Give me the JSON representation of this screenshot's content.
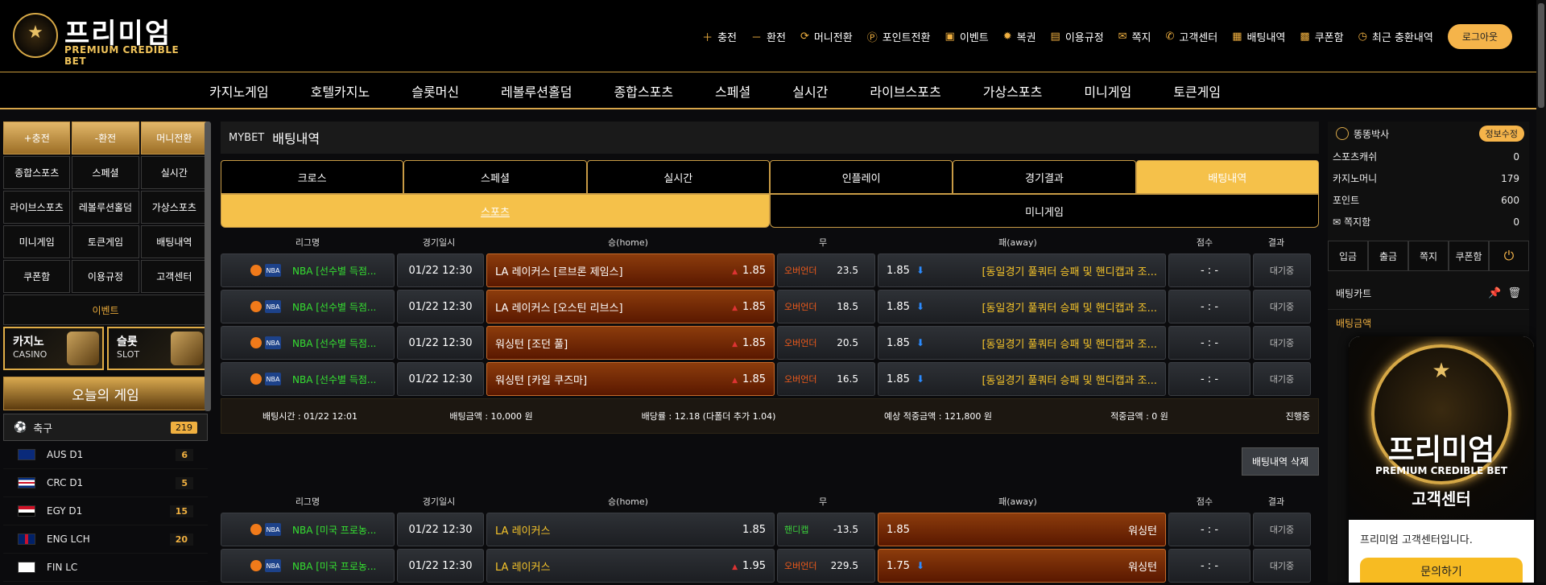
{
  "brand": {
    "name_kr": "프리미엄",
    "name_en": "PREMIUM CREDIBLE BET"
  },
  "top_menu": [
    {
      "icon": "plus-icon",
      "label": "충전"
    },
    {
      "icon": "minus-icon",
      "label": "환전"
    },
    {
      "icon": "exchange-icon",
      "label": "머니전환"
    },
    {
      "icon": "point-icon",
      "label": "포인트전환"
    },
    {
      "icon": "gift-icon",
      "label": "이벤트"
    },
    {
      "icon": "gear-icon",
      "label": "복권"
    },
    {
      "icon": "document-icon",
      "label": "이용규정"
    },
    {
      "icon": "mail-icon",
      "label": "쪽지"
    },
    {
      "icon": "phone-icon",
      "label": "고객센터"
    },
    {
      "icon": "list-icon",
      "label": "배팅내역"
    },
    {
      "icon": "grid-icon",
      "label": "쿠폰함"
    },
    {
      "icon": "clock-icon",
      "label": "최근 충환내역"
    }
  ],
  "logout": "로그아웃",
  "nav": [
    "카지노게임",
    "호텔카지노",
    "슬롯머신",
    "레볼루션홀덤",
    "종합스포츠",
    "스페셜",
    "실시간",
    "라이브스포츠",
    "가상스포츠",
    "미니게임",
    "토큰게임"
  ],
  "left_buttons": [
    "+충전",
    "-환전",
    "머니전환",
    "종합스포츠",
    "스페셜",
    "실시간",
    "라이브스포츠",
    "레볼루션홀덤",
    "가상스포츠",
    "미니게임",
    "토큰게임",
    "배팅내역",
    "쿠폰함",
    "이용규정",
    "고객센터"
  ],
  "left_event": "이벤트",
  "banners": [
    {
      "title": "카지노",
      "sub": "CASINO"
    },
    {
      "title": "슬롯",
      "sub": "SLOT"
    }
  ],
  "today": "오늘의 게임",
  "soccer": {
    "label": "축구",
    "count": "219"
  },
  "leagues": [
    {
      "name": "AUS D1",
      "count": "6"
    },
    {
      "name": "CRC D1",
      "count": "5"
    },
    {
      "name": "EGY D1",
      "count": "15"
    },
    {
      "name": "ENG LCH",
      "count": "20"
    },
    {
      "name": "FIN LC",
      "count": ""
    }
  ],
  "main": {
    "crumb": "MYBET",
    "title": "배팅내역",
    "tabs": [
      "크로스",
      "스페셜",
      "실시간",
      "인플레이",
      "경기결과",
      "배팅내역"
    ],
    "subtabs": [
      "스포츠",
      "미니게임"
    ],
    "headers": [
      "리그명",
      "경기일시",
      "승(home)",
      "무",
      "패(away)",
      "점수",
      "결과"
    ],
    "bet1": [
      {
        "league": "NBA [선수별 득점...",
        "date": "01/22 12:30",
        "home": "LA 레이커스 [르브론 제임스]",
        "home_odds": "1.85",
        "draw_type": "오버언더",
        "draw_val": "23.5",
        "away_odds": "1.85",
        "away": "[동일경기 풀쿼터 승패 및 핸디캡과 조...",
        "score": "- : -",
        "result": "대기중"
      },
      {
        "league": "NBA [선수별 득점...",
        "date": "01/22 12:30",
        "home": "LA 레이커스 [오스틴 리브스]",
        "home_odds": "1.85",
        "draw_type": "오버언더",
        "draw_val": "18.5",
        "away_odds": "1.85",
        "away": "[동일경기 풀쿼터 승패 및 핸디캡과 조...",
        "score": "- : -",
        "result": "대기중"
      },
      {
        "league": "NBA [선수별 득점...",
        "date": "01/22 12:30",
        "home": "워싱턴 [조던 풀]",
        "home_odds": "1.85",
        "draw_type": "오버언더",
        "draw_val": "20.5",
        "away_odds": "1.85",
        "away": "[동일경기 풀쿼터 승패 및 핸디캡과 조...",
        "score": "- : -",
        "result": "대기중"
      },
      {
        "league": "NBA [선수별 득점...",
        "date": "01/22 12:30",
        "home": "워싱턴 [카일 쿠즈마]",
        "home_odds": "1.85",
        "draw_type": "오버언더",
        "draw_val": "16.5",
        "away_odds": "1.85",
        "away": "[동일경기 풀쿼터 승패 및 핸디캡과 조...",
        "score": "- : -",
        "result": "대기중"
      }
    ],
    "summary": {
      "time": "배팅시간 : 01/22 12:01",
      "amount": "배팅금액 : 10,000 원",
      "rate": "배당률 : 12.18 (다폴더 추가 1.04)",
      "expected": "예상 적중금액 : 121,800 원",
      "won": "적중금액 : 0 원",
      "status": "진행중"
    },
    "delete": "배팅내역 삭제",
    "bet2": [
      {
        "league": "NBA [미국 프로농...",
        "date": "01/22 12:30",
        "home": "LA 레이커스",
        "home_odds": "1.85",
        "draw_type": "핸디캡",
        "draw_val": "-13.5",
        "away_odds": "1.85",
        "away": "워싱턴",
        "score": "- : -",
        "result": "대기중"
      },
      {
        "league": "NBA [미국 프로농...",
        "date": "01/22 12:30",
        "home": "LA 레이커스",
        "home_odds": "1.95",
        "draw_type": "오버언더",
        "draw_val": "229.5",
        "away_odds": "1.75",
        "away": "워싱턴",
        "score": "- : -",
        "result": "대기중"
      }
    ]
  },
  "right": {
    "user": "똥똥박사",
    "info_btn": "정보수정",
    "kv": [
      {
        "k": "스포츠캐쉬",
        "v": "0"
      },
      {
        "k": "카지노머니",
        "v": "179"
      },
      {
        "k": "포인트",
        "v": "600"
      },
      {
        "k": "쪽지함",
        "v": "0"
      }
    ],
    "buttons": [
      "입금",
      "출금",
      "쪽지",
      "쿠폰함"
    ],
    "betslip": "배팅카트",
    "bet_amount": "배팅금액"
  },
  "popup": {
    "t1": "프리미엄",
    "t2": "PREMIUM CREDIBLE BET",
    "t3": "고객센터",
    "msg": "프리미엄 고객센터입니다.",
    "btn": "문의하기"
  }
}
